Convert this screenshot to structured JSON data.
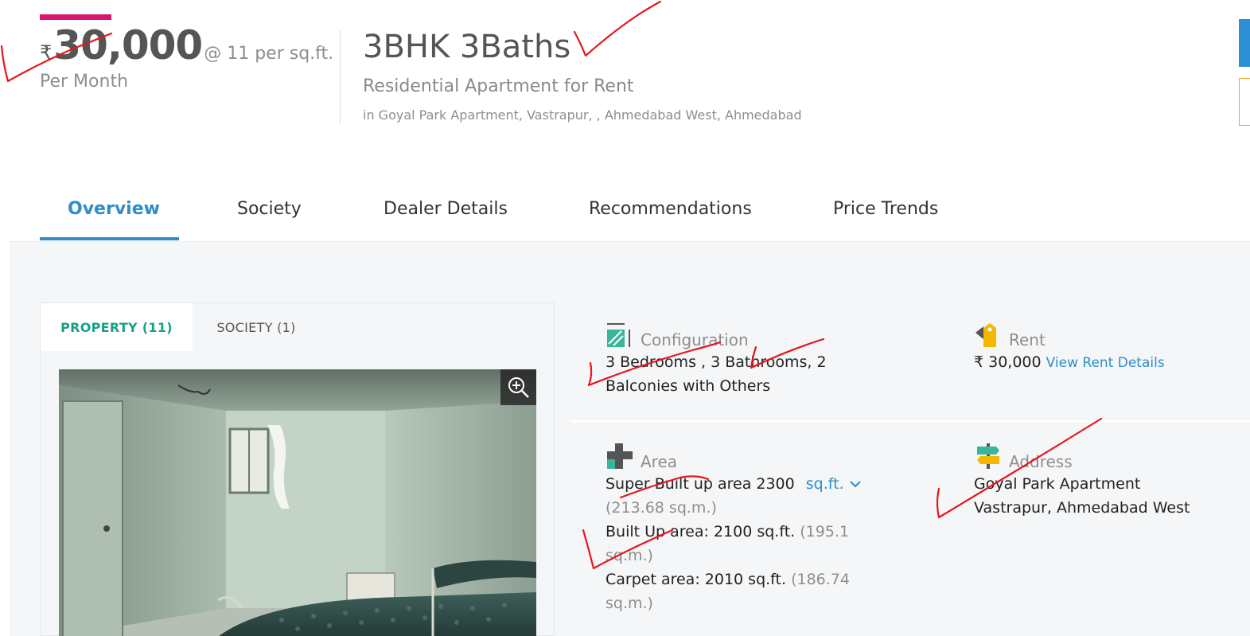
{
  "header": {
    "currency_symbol": "₹",
    "price": "30,000",
    "price_rate": "@ 11 per sq.ft.",
    "price_period": "Per Month",
    "title": "3BHK 3Baths",
    "subtitle": "Residential Apartment for Rent",
    "location": "in Goyal Park Apartment, Vastrapur, , Ahmedabad West, Ahmedabad"
  },
  "tabs": [
    {
      "label": "Overview",
      "active": true
    },
    {
      "label": "Society",
      "active": false
    },
    {
      "label": "Dealer Details",
      "active": false
    },
    {
      "label": "Recommendations",
      "active": false
    },
    {
      "label": "Price Trends",
      "active": false
    }
  ],
  "gallery": {
    "tabs": [
      {
        "label": "PROPERTY (11)",
        "active": true
      },
      {
        "label": "SOCIETY (1)",
        "active": false
      }
    ],
    "zoom_icon": "zoom-in-icon"
  },
  "details": {
    "configuration": {
      "label": "Configuration",
      "value_line1": "3 Bedrooms , 3 Bathrooms, 2",
      "value_line2": "Balconies with Others",
      "icon": "configuration-icon"
    },
    "rent": {
      "label": "Rent",
      "value": "₹ 30,000",
      "link": "View Rent Details",
      "icon": "rent-tag-icon"
    },
    "area": {
      "label": "Area",
      "super_built_up": "Super Built up area 2300",
      "unit": "sq.ft.",
      "super_built_up_sqm": "(213.68 sq.m.)",
      "built_up": "Built Up area: 2100 sq.ft.",
      "built_up_sqm_a": "(195.1",
      "built_up_sqm_b": "sq.m.)",
      "carpet": "Carpet area: 2010 sq.ft.",
      "carpet_sqm_a": "(186.74",
      "carpet_sqm_b": "sq.m.)",
      "icon": "area-icon"
    },
    "address": {
      "label": "Address",
      "line1": "Goyal Park Apartment",
      "line2": "Vastrapur, Ahmedabad West",
      "icon": "signpost-icon"
    }
  },
  "colors": {
    "accent_blue": "#2e8dc8",
    "accent_green": "#17a086",
    "brand_pink": "#d6186c",
    "annotation_red": "#e8151b"
  }
}
